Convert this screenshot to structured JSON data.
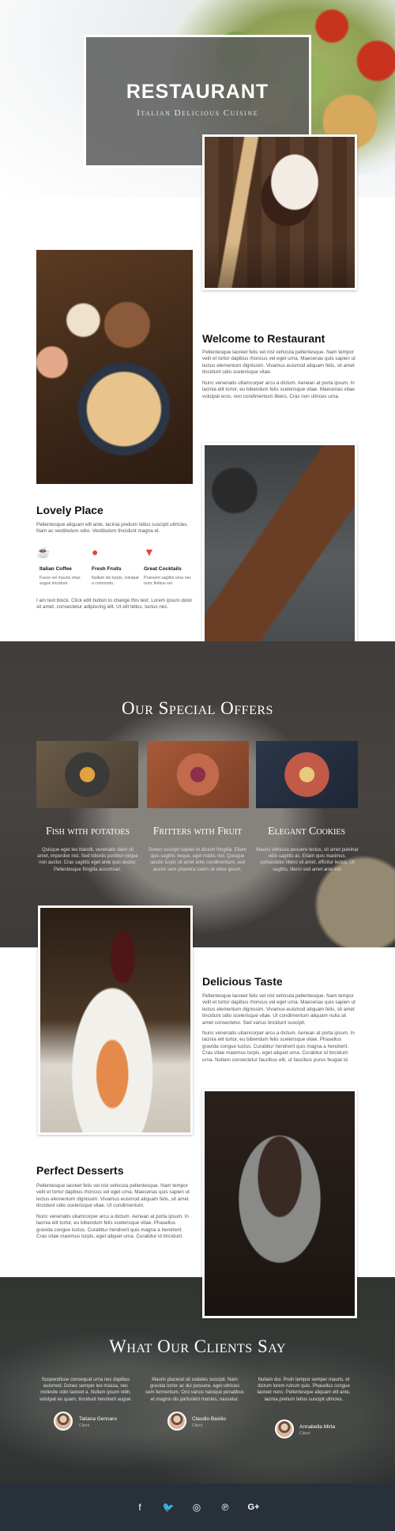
{
  "colors": {
    "accent": "#e0483d",
    "footer_bg": "#283139",
    "title_box": "#5f5f5f"
  },
  "header": {
    "title": "RESTAURANT",
    "subtitle": "Italian Delicious Cuisine"
  },
  "welcome": {
    "heading": "Welcome to Restaurant",
    "p1": "Pellentesque laoreet felis vel nisl vehicula pellentesque. Nam tempor velit et tortor dapibus rhoncus vel eget urna. Maecenas quis sapien ut lectus elementum dignissim. Vivamus euismod aliquam felis, sit amet tincidunt odio scelerisque vitae.",
    "p2": "Nunc venenatis ullamcorper arcu a dictum. Aenean at porta ipsum. In lacinia elit tortor, eu bibendum felis scelerisque vitae. Maecenas vitae volutpat eros, non condimentum libero. Cras non ultrices urna."
  },
  "lovely": {
    "heading": "Lovely Place",
    "intro": "Pellentesque aliquam elit ante, lacinia pretium tellus suscipit ultricies. Nam ac vestibulum odio. Vestibulum tincidunt magna et.",
    "features": [
      {
        "icon": "coffee-cup-icon",
        "title": "Italian Coffee",
        "text": "Fusce vel mauris vitae augue tincidunt."
      },
      {
        "icon": "apple-icon",
        "title": "Fresh Fruits",
        "text": "Nullam dui turpis, volutpat a commodo."
      },
      {
        "icon": "cocktail-icon",
        "title": "Great Cocktails",
        "text": "Praesent sagittis urna nec nunc finibus vel."
      }
    ],
    "outro": "I am text block. Click edit button to change this text. Lorem ipsum dolor sit amet, consectetur adipiscing elit. Ut elit tellus, luctus nec."
  },
  "offers": {
    "title": "Our Special Offers",
    "items": [
      {
        "name": "Fish with potatoes",
        "text": "Quisque eget leo blandit, venenatis diam sit amet, imperdiet nisl. Sed lobortis porttitor neque non auctor. Cras sagittis eget ante quis auctor. Pellentesque fringilla accumsan."
      },
      {
        "name": "Fritters with Fruit",
        "text": "Donec suscipit sapien et dictum fringilla. Etiam quis sagittis neque, eget mattis nisl. Quisque iaculis turpis sit amet ante condimentum, sed auctor sem pharetra lorem sit dolor ipsum."
      },
      {
        "name": "Elegant Cookies",
        "text": "Mauris vehicula posuere lectus, sit amet pulvinar odio sagittis ac. Etiam quis maximus, consectetur libero sit amet, efficitur lectus. Ut sagittis, libero sed amet ante est."
      }
    ]
  },
  "delicious": {
    "heading": "Delicious Taste",
    "p1": "Pellentesque laoreet felis vel nisl vehicula pellentesque. Nam tempor velit et tortor dapibus rhoncus vel eget urna. Maecenas quis sapien ut lectus elementum dignissim. Vivamus euismod aliquam felis, sit amet tincidunt odio scelerisque vitae. Ut condimentum aliquam nulla sit amet consectetur. Sed varius tincidunt suscipit.",
    "p2": "Nunc venenatis ullamcorper arcu a dictum. Aenean at porta ipsum. In lacinia elit tortor, eu bibendum felis scelerisque vitae. Phasellus gravida congue luctus. Curabitur hendrerit quis magna a hendrerit. Cras vitae maximus turpis, eget aliquet urna. Curabitur id tincidunt urna. Nullam consectetur faucibus elit, ut faucibus purus feugiat id."
  },
  "desserts": {
    "heading": "Perfect Desserts",
    "p1": "Pellentesque laoreet felis vel nisl vehicula pellentesque. Nam tempor velit et tortor dapibus rhoncus vel eget urna. Maecenas quis sapien ut lectus elementum dignissim. Vivamus euismod aliquam felis, sit amet tincidunt odio scelerisque vitae. Ut condimentum.",
    "p2": "Nunc venenatis ullamcorper arcu a dictum. Aenean at porta ipsum. In lacinia elit tortor, eu bibendum felis scelerisque vitae. Phasellus gravida congue luctus. Curabitur hendrerit quis magna a hendrerit. Cras vitae maximus turpis, eget aliquet urna. Curabitur id tincidunt."
  },
  "testimonials": {
    "title": "What Our Clients Say",
    "items": [
      {
        "quote": "Suspendisse consequat urna nec dapibus euismod. Donec semper leo massa, nec molestie odio laoreet a. Nullam ipsum nibh, volutpat eu quam, tincidunt hendrerit augue.",
        "name": "Tatiana Gennaro",
        "role": "Client"
      },
      {
        "quote": "Mauris placerat sit sodales suscipit. Nam gravida tortor ac dui posuere, eget ultricies sem fermentum. Orci varius natoque penatibus et magnis dis parturient montes, nascetur.",
        "name": "Claudio Basilio",
        "role": "Client"
      },
      {
        "quote": "Nullam dui. Proin tempor semper mauris, et dictum lorem rutrum quis. Phasellus congue laoreet nunc. Pellentesque aliquam elit ante, lacinia pretium tellus suscipit ultricies.",
        "name": "Annabella Mirta",
        "role": "Client"
      }
    ]
  },
  "footer": {
    "social": [
      {
        "icon": "facebook-icon",
        "glyph": "f"
      },
      {
        "icon": "twitter-icon",
        "glyph": "🐦"
      },
      {
        "icon": "instagram-icon",
        "glyph": "◎"
      },
      {
        "icon": "pinterest-icon",
        "glyph": "℗"
      },
      {
        "icon": "google-plus-icon",
        "glyph": "G+"
      }
    ]
  }
}
